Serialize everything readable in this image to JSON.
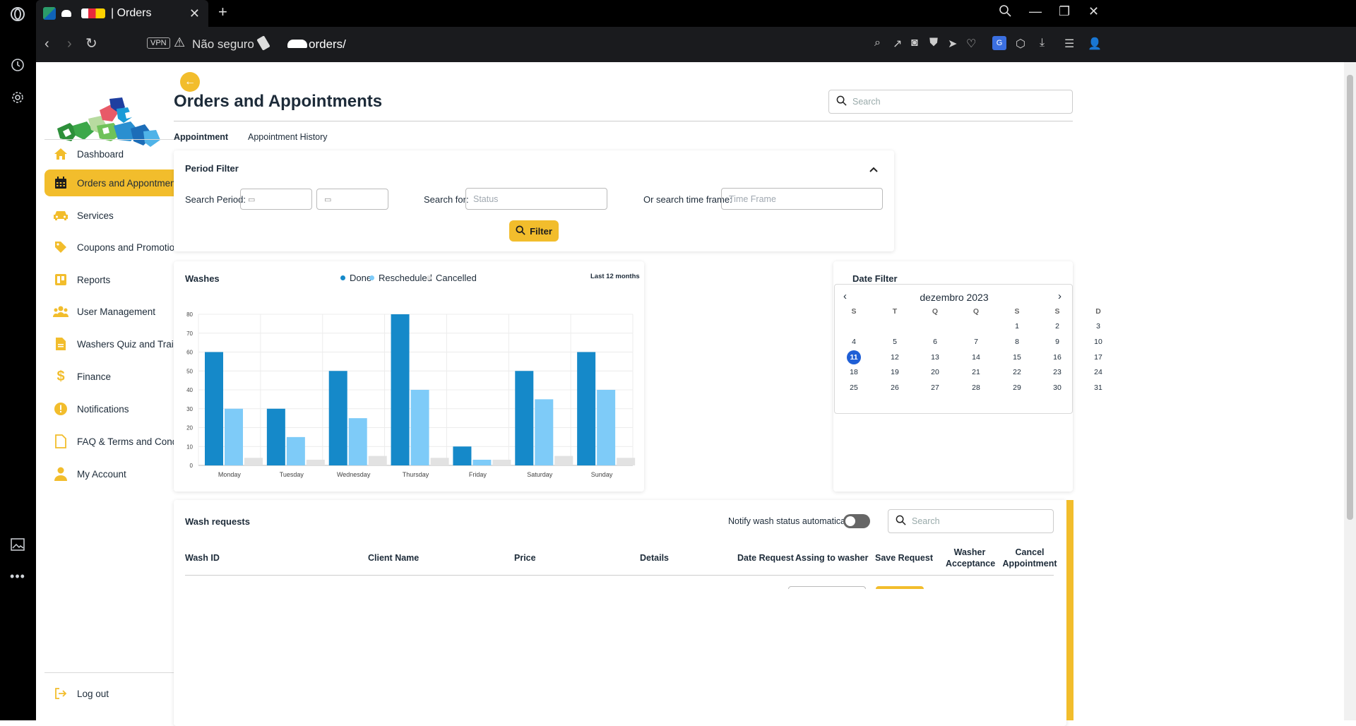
{
  "browser": {
    "tab_title": "| Orders",
    "url_security": "Não seguro",
    "url_path": "orders/",
    "vpn_label": "VPN"
  },
  "sidebar": {
    "items": [
      {
        "label": "Dashboard",
        "icon": "home-icon"
      },
      {
        "label": "Orders and Appontments",
        "icon": "calendar-icon",
        "active": true
      },
      {
        "label": "Services",
        "icon": "car-icon"
      },
      {
        "label": "Coupons and Promotions",
        "icon": "tag-icon"
      },
      {
        "label": "Reports",
        "icon": "report-icon"
      },
      {
        "label": "User Management",
        "icon": "users-icon"
      },
      {
        "label": "Washers Quiz and Training",
        "icon": "document-icon"
      },
      {
        "label": "Finance",
        "icon": "dollar-icon"
      },
      {
        "label": "Notifications",
        "icon": "alert-icon"
      },
      {
        "label": "FAQ & Terms and Conditions",
        "icon": "file-icon"
      },
      {
        "label": "My Account",
        "icon": "user-icon"
      }
    ],
    "logout_label": "Log out"
  },
  "header": {
    "title": "Orders and Appointments",
    "search_placeholder": "Search"
  },
  "tabs": [
    {
      "label": "Appointment",
      "active": true
    },
    {
      "label": "Appointment History",
      "active": false
    }
  ],
  "period_filter": {
    "title": "Period Filter",
    "search_period_label": "Search Period:",
    "search_for_label": "Search for:",
    "status_placeholder": "Status",
    "time_frame_label": "Or search time frame:",
    "time_frame_placeholder": "Time Frame",
    "filter_button": "Filter"
  },
  "washes": {
    "title": "Washes",
    "range_label": "Last 12 months",
    "colors": {
      "Done": "#1589c9",
      "Rescheduled": "#7ecbf8",
      "Cancelled": "#e2e2e2"
    }
  },
  "chart_data": {
    "type": "bar",
    "title": "Washes",
    "categories": [
      "Monday",
      "Tuesday",
      "Wednesday",
      "Thursday",
      "Friday",
      "Saturday",
      "Sunday"
    ],
    "series": [
      {
        "name": "Done",
        "values": [
          60,
          30,
          50,
          80,
          10,
          50,
          60
        ]
      },
      {
        "name": "Rescheduled",
        "values": [
          30,
          15,
          25,
          40,
          3,
          35,
          40
        ]
      },
      {
        "name": "Cancelled",
        "values": [
          4,
          3,
          5,
          4,
          3,
          5,
          4
        ]
      }
    ],
    "ylim": [
      0,
      80
    ],
    "yticks": [
      0,
      10,
      20,
      30,
      40,
      50,
      60,
      70,
      80
    ],
    "legend": "top",
    "grid": true
  },
  "date_filter": {
    "title": "Date Filter",
    "month_label": "dezembro 2023",
    "weekdays": [
      "S",
      "T",
      "Q",
      "Q",
      "S",
      "S",
      "D"
    ],
    "first_weekday_index": 4,
    "days_in_month": 31,
    "selected_day": 11
  },
  "wash_requests": {
    "title": "Wash requests",
    "notify_label": "Notify wash status automatically:",
    "search_placeholder": "Search",
    "columns": [
      "Wash ID",
      "Client Name",
      "Price",
      "Details",
      "Date Request",
      "Assing to washer",
      "Save Request",
      "Washer Acceptance",
      "Cancel Appointment"
    ]
  }
}
